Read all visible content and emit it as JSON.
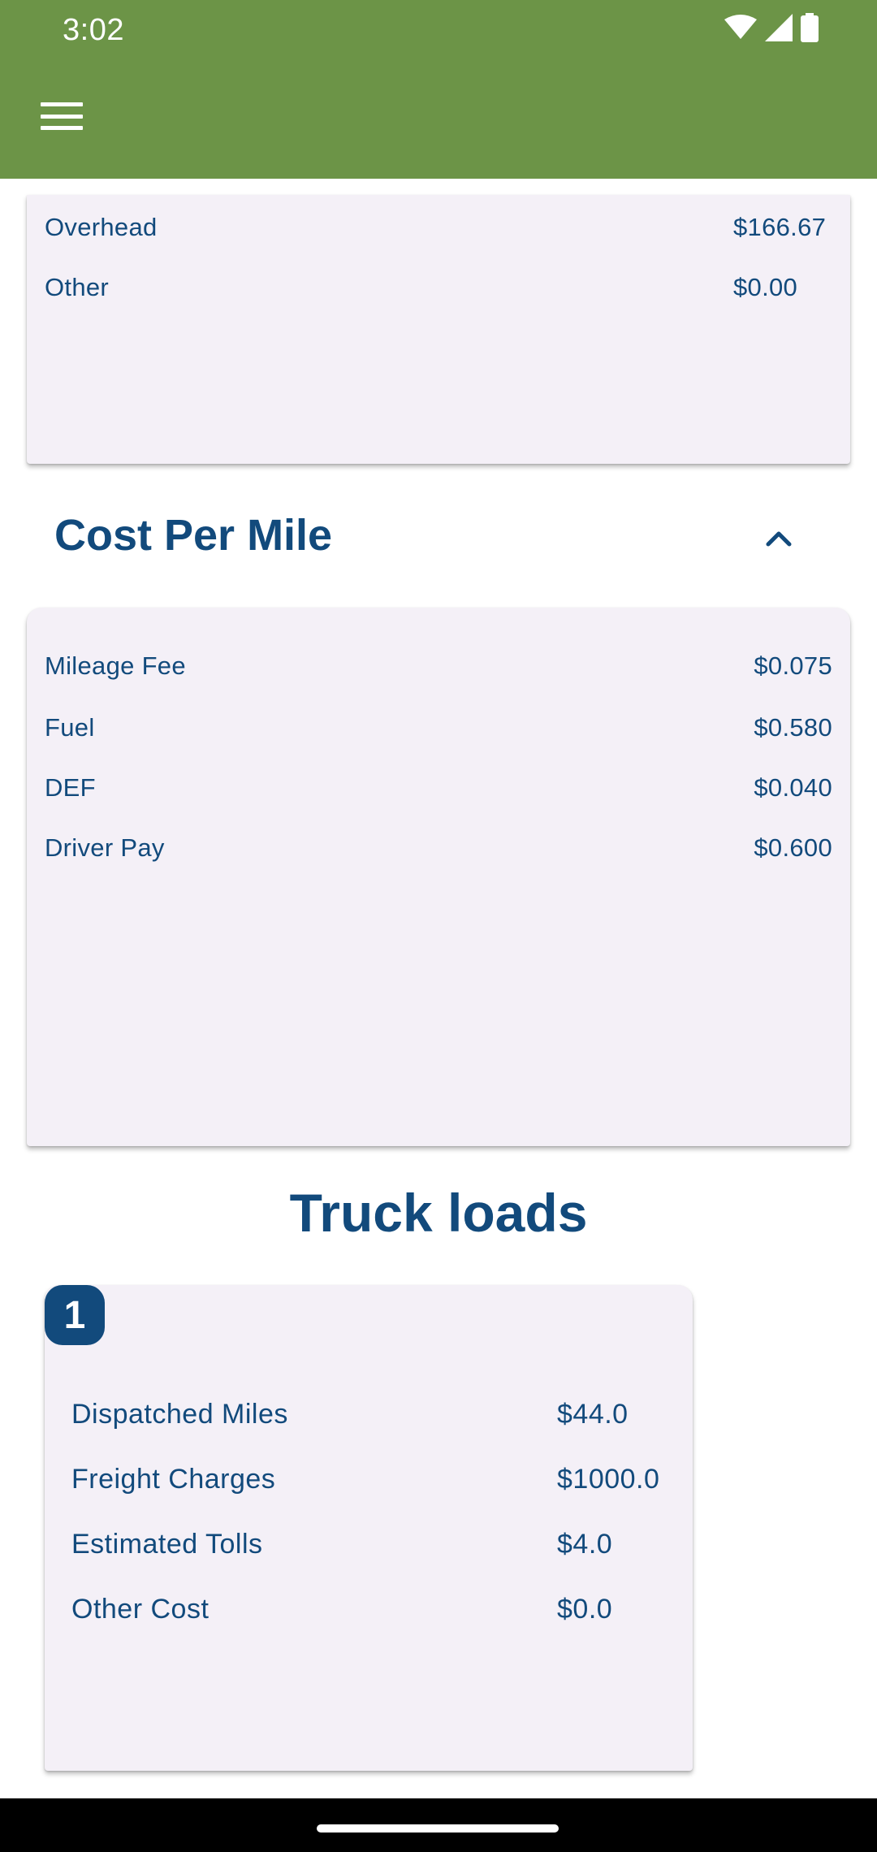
{
  "status_bar": {
    "time": "3:02",
    "icons": [
      "wifi-icon",
      "signal-icon",
      "battery-icon"
    ]
  },
  "app_bar": {
    "menu_icon": "menu-icon"
  },
  "overhead_card": {
    "rows": [
      {
        "label": "Overhead",
        "value": "$166.67"
      },
      {
        "label": "Other",
        "value": "$0.00"
      }
    ]
  },
  "cost_per_mile": {
    "title": "Cost Per Mile",
    "toggle_icon": "chevron-up-icon",
    "rows": [
      {
        "label": "Mileage Fee",
        "value": "$0.075"
      },
      {
        "label": "Fuel",
        "value": "$0.580"
      },
      {
        "label": "DEF",
        "value": "$0.040"
      },
      {
        "label": "Driver Pay",
        "value": "$0.600"
      }
    ]
  },
  "truck_loads": {
    "title": "Truck loads",
    "loads": [
      {
        "number": "1",
        "rows": [
          {
            "label": "Dispatched Miles",
            "value": "$44.0"
          },
          {
            "label": "Freight Charges",
            "value": "$1000.0"
          },
          {
            "label": "Estimated Tolls",
            "value": "$4.0"
          },
          {
            "label": "Other Cost",
            "value": "$0.0"
          }
        ]
      }
    ]
  },
  "colors": {
    "app_bar": "#6c9447",
    "primary_text": "#124a7c",
    "card_bg": "#f4f0f7"
  }
}
